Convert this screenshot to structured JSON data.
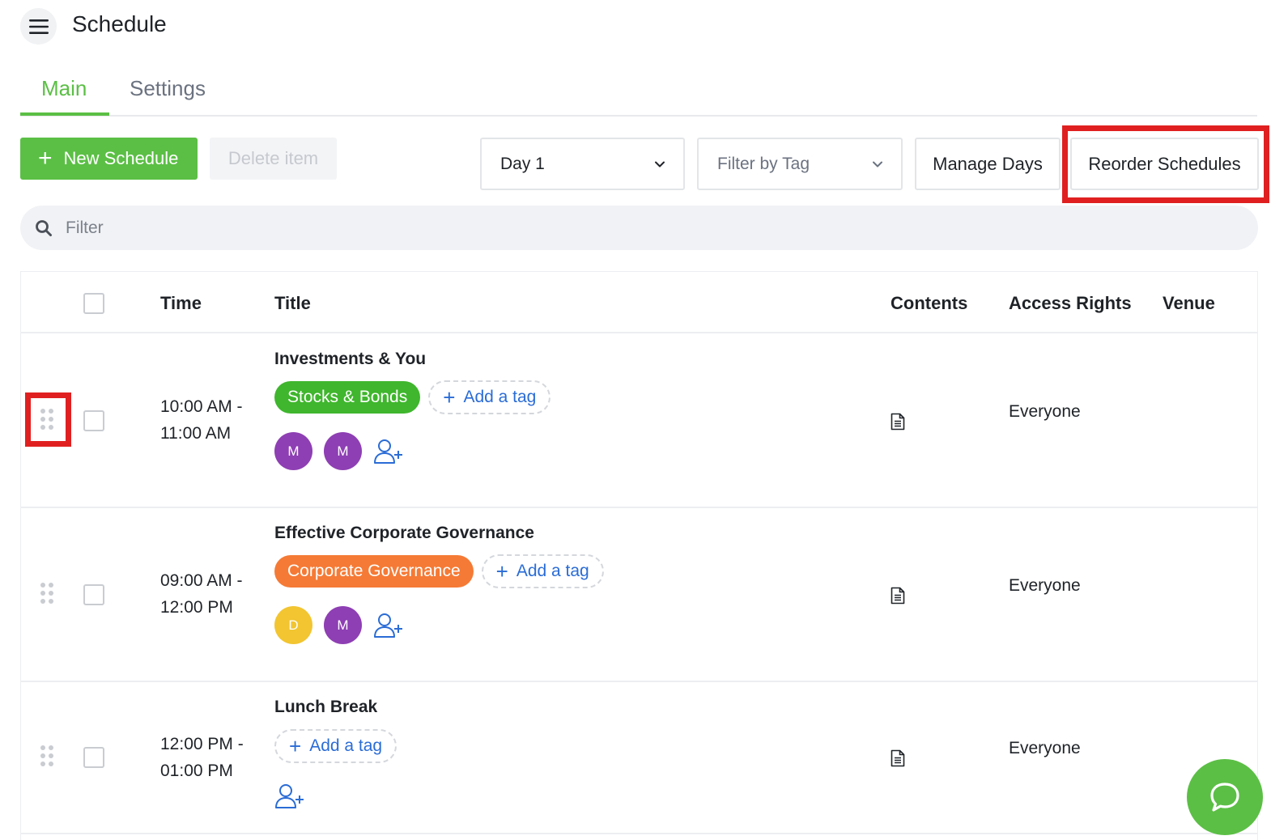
{
  "header": {
    "title": "Schedule",
    "menu_icon": "hamburger-menu-icon"
  },
  "tabs": [
    {
      "label": "Main",
      "active": true
    },
    {
      "label": "Settings",
      "active": false
    }
  ],
  "toolbar": {
    "new_schedule_label": "New Schedule",
    "delete_label": "Delete item",
    "day_select_value": "Day 1",
    "tag_filter_placeholder": "Filter by Tag",
    "manage_days_label": "Manage Days",
    "reorder_label": "Reorder Schedules"
  },
  "search": {
    "placeholder": "Filter"
  },
  "table": {
    "columns": [
      "Time",
      "Title",
      "Contents",
      "Access Rights",
      "Venue"
    ],
    "rows": [
      {
        "time_start": "10:00 AM -",
        "time_end": "11:00 AM",
        "title": "Investments & You",
        "tags": [
          {
            "label": "Stocks & Bonds",
            "color": "#3fb62d"
          }
        ],
        "add_tag_label": "Add a tag",
        "avatars": [
          {
            "initial": "M",
            "color": "#8e3fb3"
          },
          {
            "initial": "M",
            "color": "#8e3fb3"
          }
        ],
        "access": "Everyone"
      },
      {
        "time_start": "09:00 AM -",
        "time_end": "12:00 PM",
        "title": "Effective Corporate Governance",
        "tags": [
          {
            "label": "Corporate Governance",
            "color": "#f57a35"
          }
        ],
        "add_tag_label": "Add a tag",
        "avatars": [
          {
            "initial": "D",
            "color": "#f2c531"
          },
          {
            "initial": "M",
            "color": "#8e3fb3"
          }
        ],
        "access": "Everyone"
      },
      {
        "time_start": "12:00 PM -",
        "time_end": "01:00 PM",
        "title": "Lunch Break",
        "tags": [],
        "add_tag_label": "Add a tag",
        "avatars": [],
        "access": "Everyone"
      }
    ]
  },
  "colors": {
    "accent": "#5bbf45",
    "link": "#2a6cd6",
    "highlight": "#e02020"
  }
}
